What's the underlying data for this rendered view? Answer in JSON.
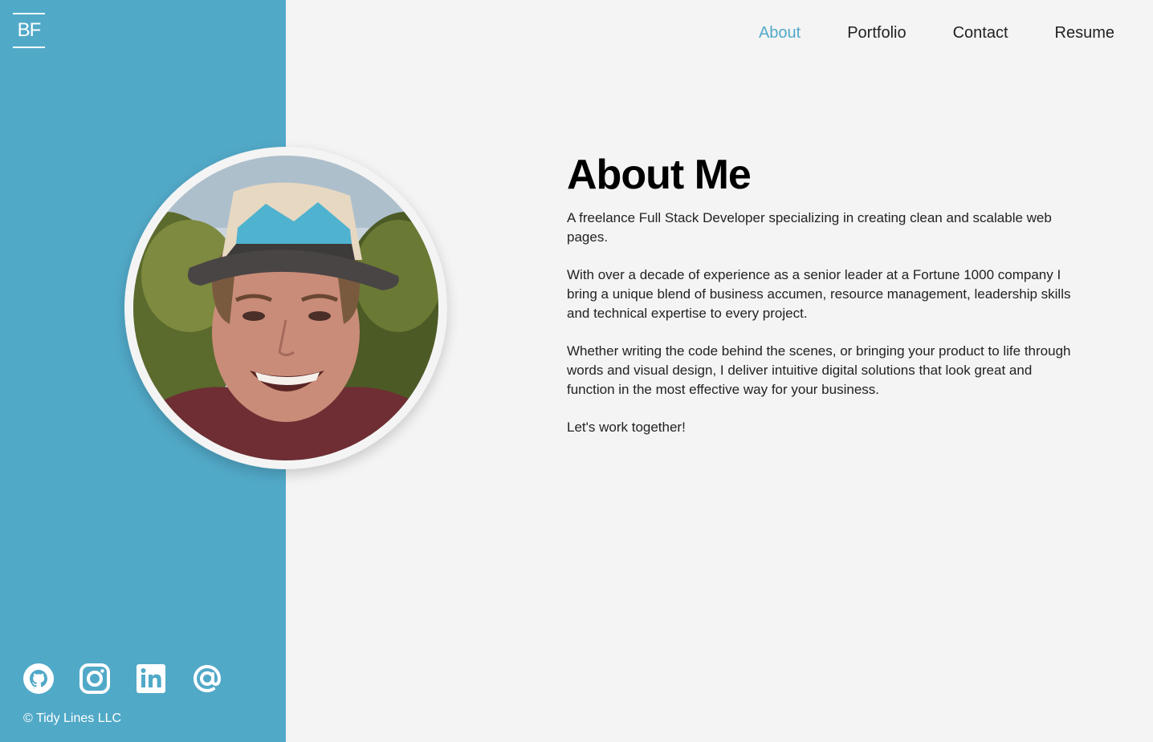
{
  "brand": {
    "logo_text": "BF",
    "accent": "#51a9c8"
  },
  "nav": {
    "items": [
      {
        "label": "About",
        "active": true
      },
      {
        "label": "Portfolio",
        "active": false
      },
      {
        "label": "Contact",
        "active": false
      },
      {
        "label": "Resume",
        "active": false
      }
    ]
  },
  "profile": {
    "photo_icon": "profile-photo"
  },
  "about": {
    "title": "About Me",
    "paragraphs": [
      "A freelance Full Stack Developer specializing in creating clean and scalable web pages.",
      "With over a decade of experience as a senior leader at a Fortune 1000 company I bring a unique blend of business accumen, resource management, leadership skills and technical expertise to every project.",
      "Whether writing the code behind the scenes, or bringing your product to life through words and visual design, I deliver intuitive digital solutions that look great and function in the most effective way for your business.",
      "Let's work together!"
    ]
  },
  "socials": {
    "icons": [
      "github-icon",
      "instagram-icon",
      "linkedin-icon",
      "email-at-icon"
    ]
  },
  "footer": {
    "copyright": "© Tidy Lines LLC"
  }
}
